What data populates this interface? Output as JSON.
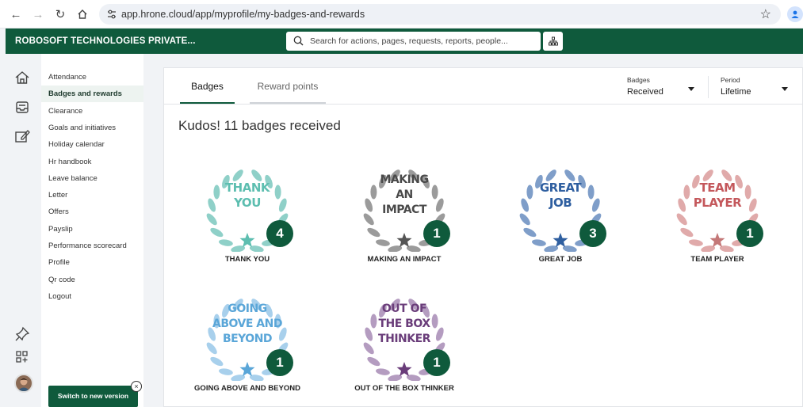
{
  "browser": {
    "url": "app.hrone.cloud/app/myprofile/my-badges-and-rewards"
  },
  "header": {
    "company": "ROBOSOFT TECHNOLOGIES PRIVATE...",
    "search_placeholder": "Search for actions, pages, requests, reports, people..."
  },
  "rail_icons": [
    "home-icon",
    "inbox-icon",
    "edit-icon",
    "pin-icon",
    "apps-add-icon"
  ],
  "submenu": {
    "items": [
      {
        "label": "Attendance"
      },
      {
        "label": "Badges and rewards"
      },
      {
        "label": "Clearance"
      },
      {
        "label": "Goals and initiatives"
      },
      {
        "label": "Holiday calendar"
      },
      {
        "label": "Hr handbook"
      },
      {
        "label": "Leave balance"
      },
      {
        "label": "Letter"
      },
      {
        "label": "Offers"
      },
      {
        "label": "Payslip"
      },
      {
        "label": "Performance scorecard"
      },
      {
        "label": "Profile"
      },
      {
        "label": "Qr code"
      },
      {
        "label": "Logout"
      }
    ],
    "active_index": 1,
    "switch_label": "Switch to new version",
    "switch_close": "×"
  },
  "tabs": {
    "badges": "Badges",
    "rewards": "Reward points"
  },
  "filters": {
    "badges_label": "Badges",
    "badges_value": "Received",
    "period_label": "Period",
    "period_value": "Lifetime"
  },
  "kudos_text": "Kudos! 11 badges received",
  "badges": [
    {
      "name": "THANK YOU",
      "lines": [
        "THANK",
        "YOU"
      ],
      "count": "4",
      "wreath": "#8fd0c8",
      "text": "#5dbeb0",
      "star": "#5dbeb0"
    },
    {
      "name": "MAKING AN IMPACT",
      "lines": [
        "MAKING",
        "AN",
        "IMPACT"
      ],
      "count": "1",
      "wreath": "#9b9b9b",
      "text": "#4a4a4a",
      "star": "#555555"
    },
    {
      "name": "GREAT JOB",
      "lines": [
        "GREAT",
        "JOB"
      ],
      "count": "3",
      "wreath": "#7f9ec9",
      "text": "#2f5fa0",
      "star": "#2f5fa0"
    },
    {
      "name": "TEAM PLAYER",
      "lines": [
        "TEAM",
        "PLAYER"
      ],
      "count": "1",
      "wreath": "#e0aaaa",
      "text": "#c4585c",
      "star": "#c47878"
    },
    {
      "name": "GOING ABOVE AND BEYOND",
      "lines": [
        "GOING",
        "ABOVE AND",
        "BEYOND"
      ],
      "count": "1",
      "wreath": "#a8d0ec",
      "text": "#5aa6d8",
      "star": "#5aa6d8"
    },
    {
      "name": "OUT OF THE BOX THINKER",
      "lines": [
        "OUT OF",
        "THE BOX",
        "THINKER"
      ],
      "count": "1",
      "wreath": "#b49cc0",
      "text": "#6a3d7a",
      "star": "#6a3d7a"
    }
  ]
}
